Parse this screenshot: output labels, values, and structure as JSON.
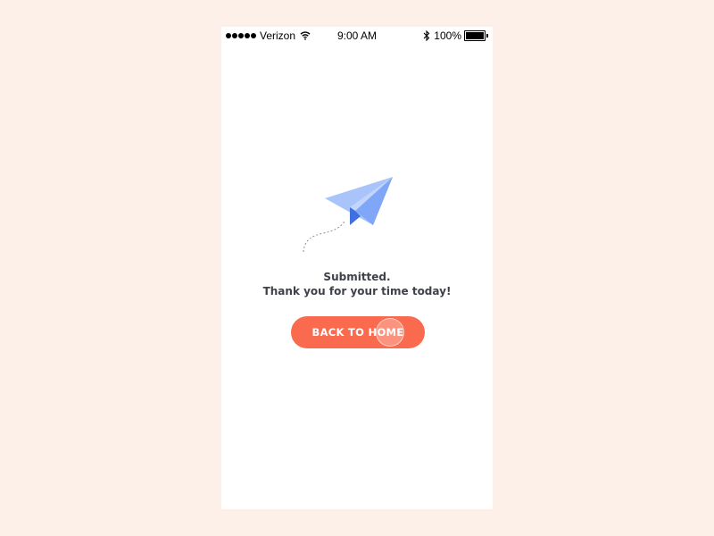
{
  "status_bar": {
    "carrier": "Verizon",
    "time": "9:00 AM",
    "battery": "100%"
  },
  "confirmation": {
    "line1": "Submitted.",
    "line2": "Thank you for your time today!"
  },
  "back_button": {
    "label": "BACK TO HOME"
  },
  "colors": {
    "background": "#fdf0e8",
    "screen": "#ffffff",
    "button": "#fa6a4e",
    "text": "#3e4149",
    "plane_light": "#a9c4fb",
    "plane_mid": "#7fa6f7",
    "plane_dark": "#3f6fe0"
  },
  "icons": {
    "signal": "signal-dots-icon",
    "wifi": "wifi-icon",
    "bluetooth": "bluetooth-icon",
    "battery": "battery-icon",
    "illustration": "paper-plane-icon"
  }
}
